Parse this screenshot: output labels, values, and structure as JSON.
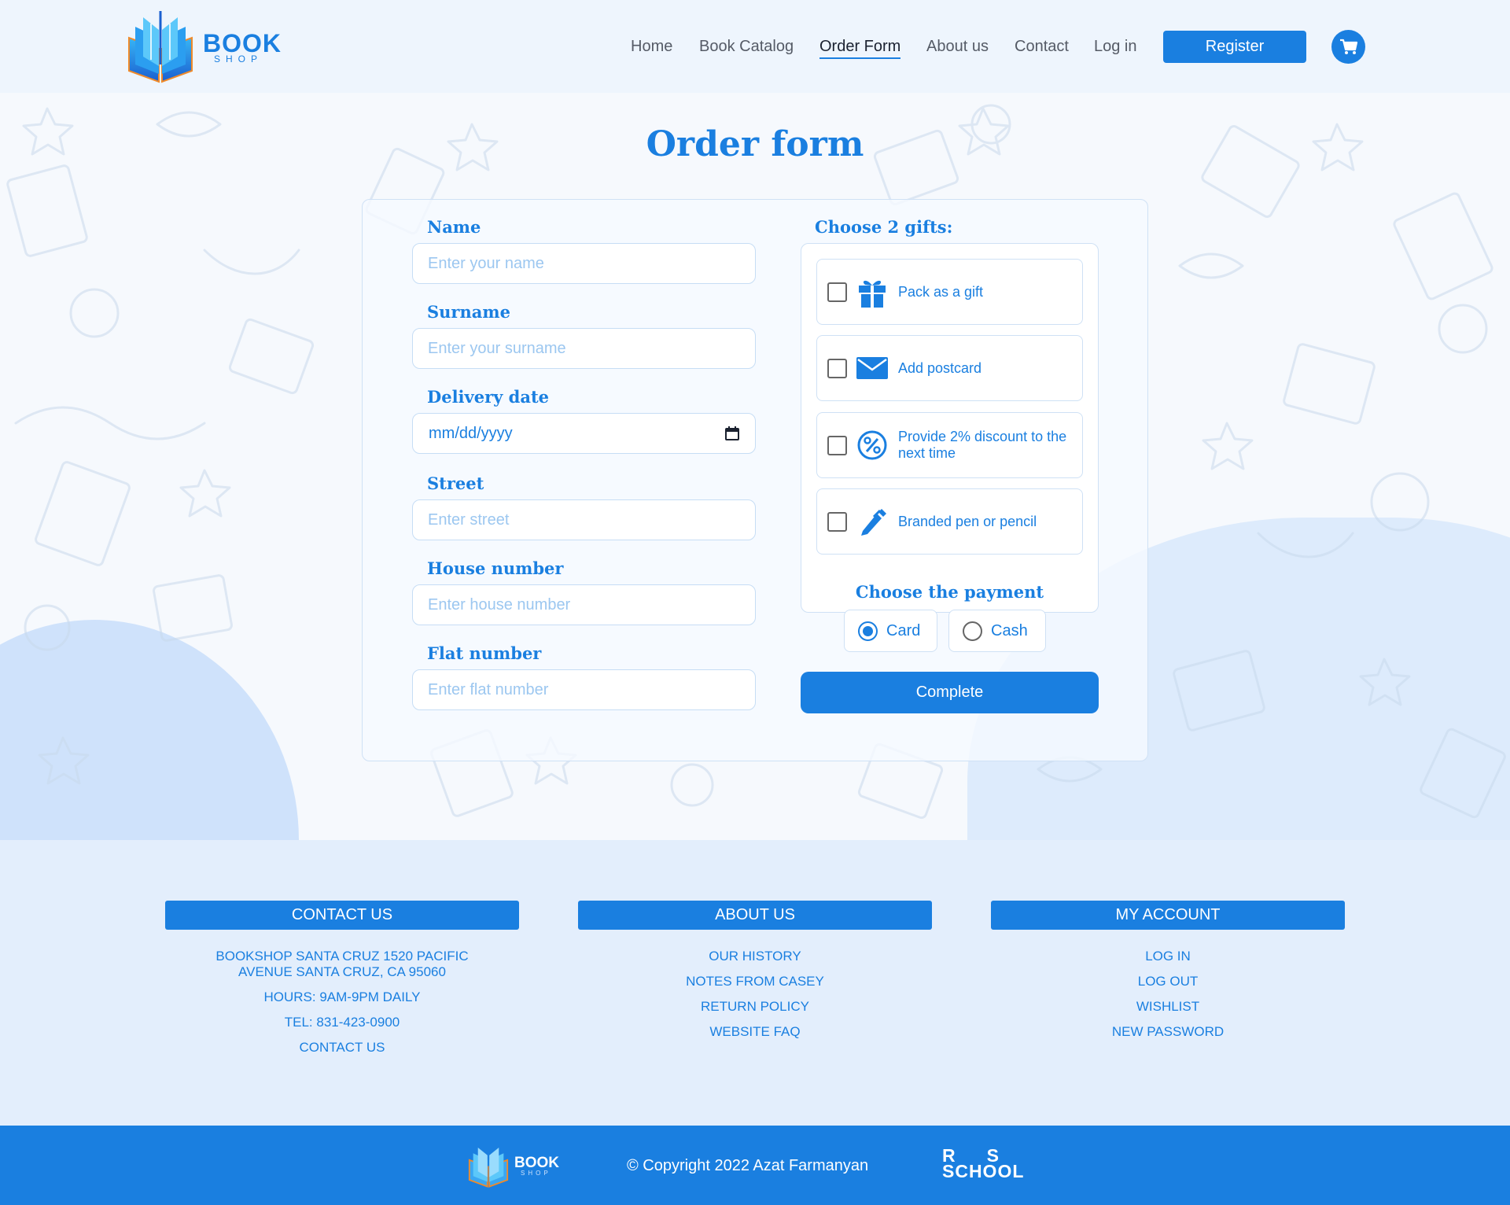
{
  "header": {
    "logo": {
      "main": "BOOK",
      "sub": "SHOP"
    },
    "nav": [
      {
        "label": "Home",
        "active": false
      },
      {
        "label": "Book Catalog",
        "active": false
      },
      {
        "label": "Order Form",
        "active": true
      },
      {
        "label": "About us",
        "active": false
      },
      {
        "label": "Contact",
        "active": false
      },
      {
        "label": "Log in",
        "active": false
      }
    ],
    "register_label": "Register",
    "cart_icon": "cart-icon"
  },
  "page": {
    "title": "Order form"
  },
  "form": {
    "fields": [
      {
        "label": "Name",
        "placeholder": "Enter your name"
      },
      {
        "label": "Surname",
        "placeholder": "Enter your surname"
      },
      {
        "label": "Delivery date",
        "value": "mm/dd/yyyy",
        "icon": "calendar-icon"
      },
      {
        "label": "Street",
        "placeholder": "Enter street"
      },
      {
        "label": "House number",
        "placeholder": "Enter house number"
      },
      {
        "label": "Flat number",
        "placeholder": "Enter flat number"
      }
    ],
    "gifts_label": "Choose 2 gifts:",
    "gifts": [
      {
        "label": "Pack as a gift",
        "icon": "gift-icon",
        "checked": false
      },
      {
        "label": "Add postcard",
        "icon": "envelope-icon",
        "checked": false
      },
      {
        "label": "Provide 2% discount to the next time",
        "icon": "percent-icon",
        "checked": false
      },
      {
        "label": "Branded pen or pencil",
        "icon": "pen-icon",
        "checked": false
      }
    ],
    "payment_label": "Choose the payment",
    "payment_options": [
      {
        "label": "Card",
        "checked": true
      },
      {
        "label": "Cash",
        "checked": false
      }
    ],
    "submit_label": "Complete"
  },
  "footer": {
    "columns": [
      {
        "title": "CONTACT US",
        "links": [
          "BOOKSHOP SANTA CRUZ 1520 PACIFIC AVENUE SANTA CRUZ, CA 95060",
          "HOURS: 9AM-9PM DAILY",
          "TEL: 831-423-0900",
          "CONTACT US"
        ]
      },
      {
        "title": "ABOUT US",
        "links": [
          "OUR HISTORY",
          "NOTES FROM CASEY",
          "RETURN POLICY",
          "WEBSITE FAQ"
        ]
      },
      {
        "title": "MY ACCOUNT",
        "links": [
          "LOG IN",
          "LOG OUT",
          "WISHLIST",
          "NEW PASSWORD"
        ]
      }
    ],
    "bottom": {
      "logo_main": "BOOK",
      "logo_sub": "SHOP",
      "copyright": "© Copyright 2022 Azat Farmanyan",
      "rs_top": "RS",
      "rs_bottom": "SCHOOL"
    }
  },
  "colors": {
    "accent": "#1a7fe0",
    "background": "#f6f9fd",
    "blob": "#cfe2fb"
  }
}
